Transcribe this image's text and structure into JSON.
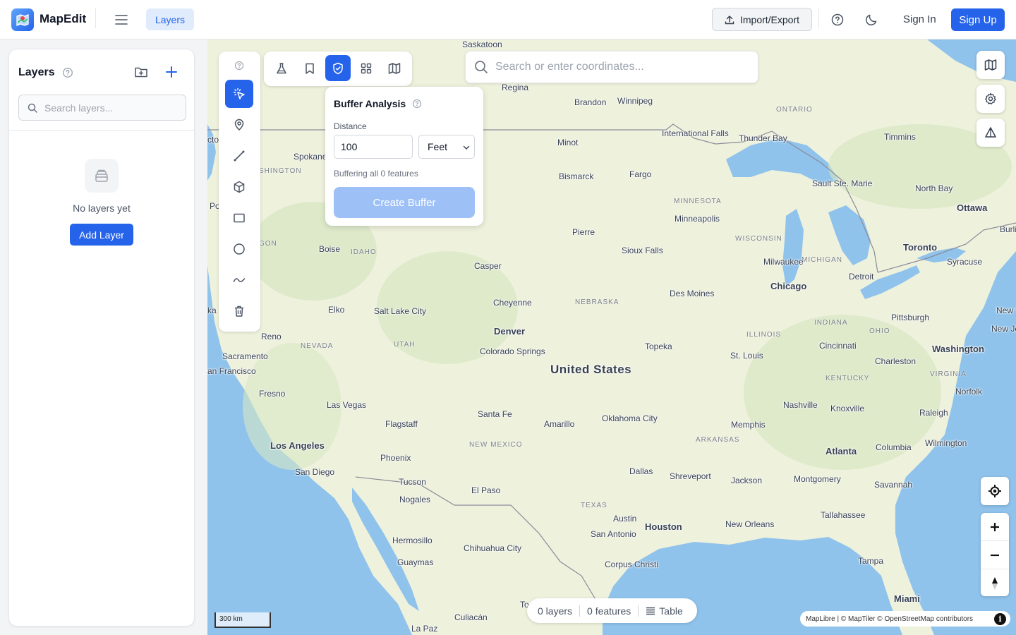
{
  "app": {
    "name": "MapEdit"
  },
  "header": {
    "layers_tab": "Layers",
    "import_export": "Import/Export",
    "sign_in": "Sign In",
    "sign_up": "Sign Up",
    "icons": [
      "menu-icon",
      "upload-icon",
      "help-icon",
      "moon-icon"
    ]
  },
  "sidebar": {
    "title": "Layers",
    "search_placeholder": "Search layers...",
    "empty_text": "No layers yet",
    "add_layer": "Add Layer"
  },
  "draw_toolbar": {
    "tools": [
      "help-icon",
      "select-icon",
      "point-icon",
      "line-icon",
      "polygon-icon",
      "rectangle-icon",
      "circle-icon",
      "freehand-icon",
      "trash-icon"
    ],
    "active": "select-icon"
  },
  "analysis_toolbar": {
    "tools": [
      "flask-icon",
      "bookmark-icon",
      "shield-icon",
      "grid-icon",
      "map-icon"
    ],
    "active": "shield-icon"
  },
  "buffer_panel": {
    "title": "Buffer Analysis",
    "distance_label": "Distance",
    "distance_value": "100",
    "unit": "Feet",
    "note": "Buffering all 0 features",
    "create_button": "Create Buffer"
  },
  "map_search": {
    "placeholder": "Search or enter coordinates..."
  },
  "status": {
    "layers": "0 layers",
    "features": "0 features",
    "table": "Table"
  },
  "scale": "300 km",
  "attribution": "MapLibre | © MapTiler © OpenStreetMap contributors",
  "map_labels": {
    "country": "United States",
    "cities": [
      "Saskatoon",
      "Regina",
      "Brandon",
      "Winnipeg",
      "International Falls",
      "Thunder Bay",
      "Timmins",
      "Minot",
      "Bismarck",
      "Fargo",
      "Sault Ste. Marie",
      "North Bay",
      "Ottawa",
      "Spokane",
      "Minneapolis",
      "Pierre",
      "Sioux Falls",
      "Toronto",
      "Syracuse",
      "Boise",
      "Casper",
      "Milwaukee",
      "Detroit",
      "Chicago",
      "Des Moines",
      "Elko",
      "Salt Lake City",
      "Cheyenne",
      "Reno",
      "Denver",
      "Pittsburgh",
      "Colorado Springs",
      "Topeka",
      "Cincinnati",
      "Washington",
      "Sacramento",
      "St. Louis",
      "Charleston",
      "Fresno",
      "Las Vegas",
      "Santa Fe",
      "Amarillo",
      "Oklahoma City",
      "Nashville",
      "Knoxville",
      "Norfolk",
      "Flagstaff",
      "Memphis",
      "Raleigh",
      "Los Angeles",
      "Phoenix",
      "Atlanta",
      "Columbia",
      "Wilmington",
      "San Diego",
      "Dallas",
      "Shreveport",
      "Jackson",
      "Montgomery",
      "Savannah",
      "Tucson",
      "El Paso",
      "Nogales",
      "Austin",
      "Houston",
      "New Orleans",
      "Tallahassee",
      "San Antonio",
      "Hermosillo",
      "Chihuahua City",
      "Guaymas",
      "Corpus Christi",
      "Tampa",
      "Culiacán",
      "La Paz",
      "Miami",
      "Burli",
      "New Yo",
      "New Jerse",
      "an Francisco",
      "Po",
      "cto",
      "ka",
      "To"
    ],
    "regions": [
      "ONTARIO",
      "MINNESOTA",
      "WISCONSIN",
      "MICHIGAN",
      "IDAHO",
      "NEBRASKA",
      "NEVADA",
      "UTAH",
      "ILLINOIS",
      "INDIANA",
      "OHIO",
      "KENTUCKY",
      "VIRGINIA",
      "NEW MEXICO",
      "ARKANSAS",
      "TEXAS",
      "SHINGTON",
      "GON"
    ]
  }
}
